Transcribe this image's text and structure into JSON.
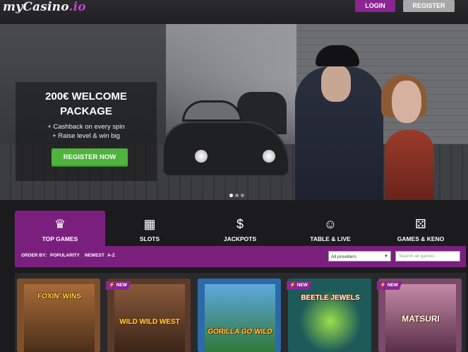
{
  "header": {
    "logo_main": "myCasino",
    "logo_suffix": ".io",
    "login_label": "LOGIN",
    "register_label": "REGISTER"
  },
  "hero": {
    "title_line1": "200€ WELCOME",
    "title_line2": "PACKAGE",
    "bullet1": "+ Cashback on every spin",
    "bullet2": "+ Raise level & win big",
    "cta_label": "REGISTER NOW"
  },
  "categories": [
    {
      "label": "TOP GAMES",
      "icon": "crown-icon",
      "glyph": "♛"
    },
    {
      "label": "SLOTS",
      "icon": "slot-machine-icon",
      "glyph": "▦"
    },
    {
      "label": "JACKPOTS",
      "icon": "money-bag-icon",
      "glyph": "$"
    },
    {
      "label": "TABLE & LIVE",
      "icon": "dealer-icon",
      "glyph": "☺"
    },
    {
      "label": "GAMES & KENO",
      "icon": "dice-icon",
      "glyph": "⚄"
    }
  ],
  "filters": {
    "order_by_label": "ORDER BY:",
    "options": [
      "POPULARITY",
      "NEWEST",
      "A-Z"
    ],
    "provider_selected": "All providers",
    "search_placeholder": "Search all games"
  },
  "games": [
    {
      "title": "FOXIN' WINS",
      "new": false,
      "color": "#7d4f2a"
    },
    {
      "title": "WILD WILD WEST",
      "new": true,
      "new_label": "NEW",
      "color": "#5a3a2a"
    },
    {
      "title": "GORILLA GO WILD",
      "new": false,
      "color": "#2c6aa8"
    },
    {
      "title": "BEETLE JEWELS",
      "new": true,
      "new_label": "NEW",
      "color": "#1e5a5a"
    },
    {
      "title": "MATSURI",
      "new": true,
      "new_label": "NEW",
      "color": "#7a4a6a"
    }
  ],
  "colors": {
    "accent": "#7b1f7f",
    "cta_green": "#4fb33e"
  }
}
